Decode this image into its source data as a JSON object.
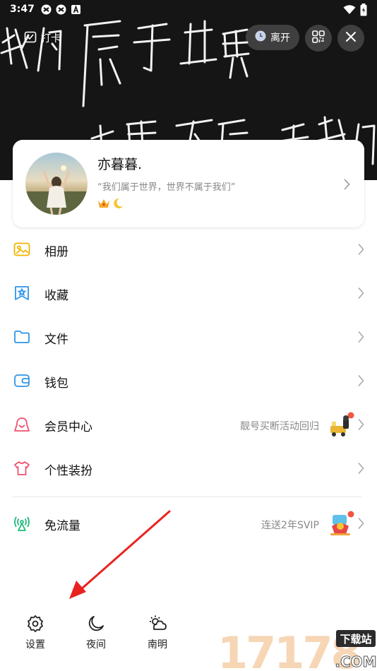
{
  "status_bar": {
    "time": "3:47"
  },
  "header": {
    "checkin_label": "打卡",
    "away_label": "离开"
  },
  "profile": {
    "nickname": "亦暮暮.",
    "signature": "“我们属于世界，世界不属于我们”"
  },
  "menu": [
    {
      "label": "相册",
      "icon": "album-icon",
      "color": "#f2b400"
    },
    {
      "label": "收藏",
      "icon": "favorites-icon",
      "color": "#2f95e8"
    },
    {
      "label": "文件",
      "icon": "folder-icon",
      "color": "#2f95e8"
    },
    {
      "label": "钱包",
      "icon": "wallet-icon",
      "color": "#2f95e8"
    },
    {
      "label": "会员中心",
      "icon": "vip-icon",
      "color": "#f0506e",
      "hint": "靓号买断活动回归"
    },
    {
      "label": "个性装扮",
      "icon": "shirt-icon",
      "color": "#f0506e"
    },
    {
      "label": "免流量",
      "icon": "signal-icon",
      "color": "#1fba7a",
      "hint": "连送2年SVIP"
    }
  ],
  "bottom_bar": {
    "settings_label": "设置",
    "night_label": "夜间",
    "weather_label": "南明"
  },
  "watermark": {
    "text_top": "下载站",
    "text_main": "17178",
    "text_com": ".COM"
  }
}
